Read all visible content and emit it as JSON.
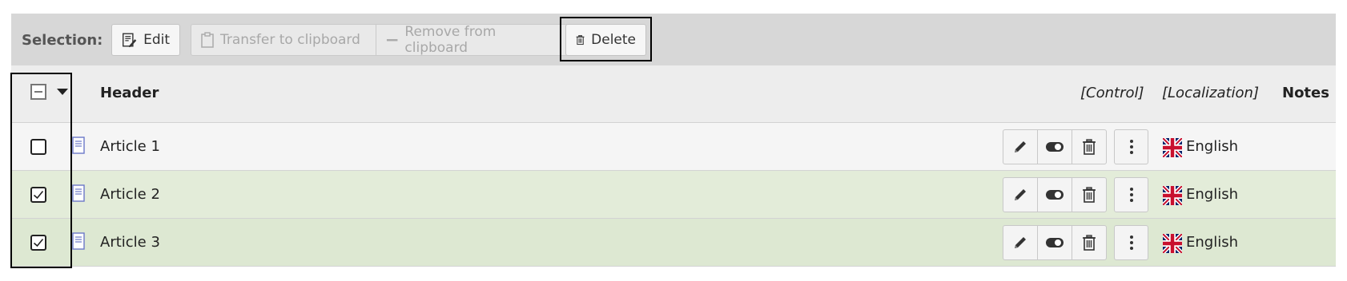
{
  "selection_bar": {
    "label": "Selection:",
    "edit_label": "Edit",
    "transfer_label": "Transfer to clipboard",
    "remove_label": "Remove from clipboard",
    "delete_label": "Delete"
  },
  "table": {
    "columns": {
      "header": "Header",
      "control": "[Control]",
      "localization": "[Localization]",
      "notes": "Notes"
    },
    "rows": [
      {
        "title": "Article 1",
        "checked": false,
        "language": "English"
      },
      {
        "title": "Article 2",
        "checked": true,
        "language": "English"
      },
      {
        "title": "Article 3",
        "checked": true,
        "language": "English"
      }
    ]
  },
  "icons": {
    "edit": "pencil-icon",
    "toggle": "toggle-icon",
    "delete": "trash-icon",
    "more": "more-vertical-icon",
    "record": "document-icon",
    "flag": "uk-flag-icon"
  },
  "colors": {
    "selected_row": "#e3ecd9",
    "selection_bar": "#d7d7d7",
    "header_bg": "#ededed"
  }
}
